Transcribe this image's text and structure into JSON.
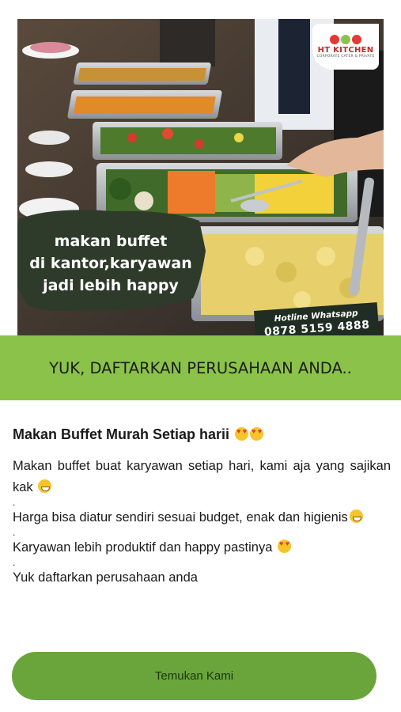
{
  "ad": {
    "brand_name": "HT KITCHEN",
    "brand_tagline": "CORPORATE CATER & PRIVATE",
    "brand_dot_colors": [
      "#e53935",
      "#8bc34a",
      "#e53935"
    ],
    "headline_lines": [
      "makan buffet",
      "di kantor,karyawan",
      "jadi lebih happy"
    ],
    "hotline_label": "Hotline Whatsapp",
    "hotline_number": "0878 5159 4888",
    "cta_banner": "YUK, DAFTARKAN PERUSAHAAN ANDA.."
  },
  "post": {
    "title": "Makan Buffet Murah Setiap harii",
    "title_emoji": "heart-eyes-emoji",
    "line1": "Makan buffet buat karyawan setiap hari, kami aja yang sajikan kak",
    "line1_emoji": "grinning-emoji",
    "sep1": ".",
    "line2": "Harga bisa diatur sendiri sesuai budget, enak dan higienis",
    "line2_emoji": "grinning-emoji",
    "sep2": ".",
    "line3": "Karyawan lebih produktif dan happy pastinya",
    "line3_emoji": "smiling-hearts-emoji",
    "sep3": ".",
    "line4": "Yuk daftarkan perusahaan anda"
  },
  "footer": {
    "button_label": "Temukan Kami"
  },
  "colors": {
    "accent_green": "#8bc34a",
    "button_green": "#6aa53c",
    "brush_dark": "#2e3b2a"
  }
}
